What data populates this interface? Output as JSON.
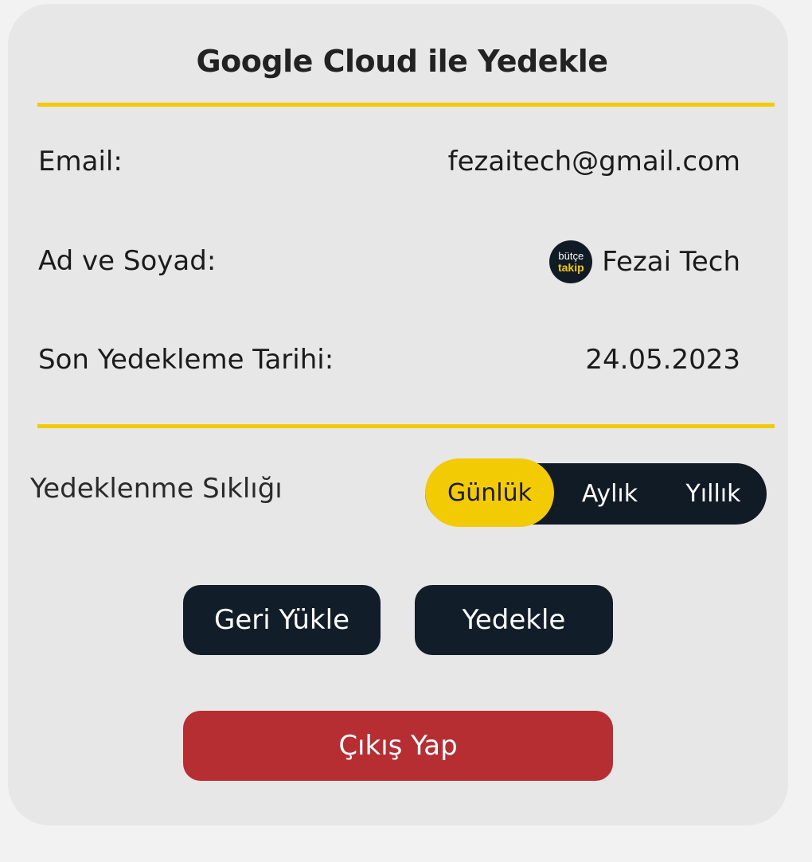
{
  "title": "Google Cloud ile Yedekle",
  "email": {
    "label": "Email:",
    "value": "fezaitech@gmail.com"
  },
  "name": {
    "label": "Ad ve Soyad:",
    "logo_line1": "bütçe",
    "logo_line2": "takip",
    "value": "Fezai Tech"
  },
  "last_backup": {
    "label": "Son Yedekleme Tarihi:",
    "value": "24.05.2023"
  },
  "frequency": {
    "label": "Yedeklenme Sıklığı",
    "options": [
      "Günlük",
      "Aylık",
      "Yıllık"
    ],
    "selected": "Günlük"
  },
  "buttons": {
    "restore": "Geri Yükle",
    "backup": "Yedekle",
    "logout": "Çıkış Yap"
  },
  "colors": {
    "accent": "#f2cb05",
    "dark": "#111d28",
    "danger": "#b62d32",
    "card": "#e8e7e7"
  }
}
